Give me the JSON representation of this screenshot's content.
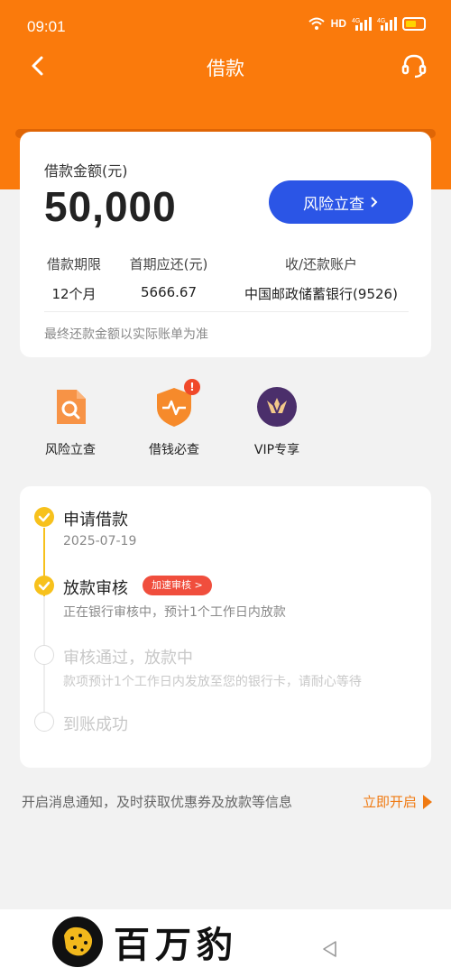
{
  "status_bar": {
    "time": "09:01",
    "hd_label": "HD",
    "signal_1": "4G",
    "signal_2": "4G"
  },
  "nav": {
    "title": "借款"
  },
  "loan": {
    "amount_label": "借款金额(元)",
    "amount": "50,000",
    "risk_button": "风险立查",
    "term_label": "借款期限",
    "term_value": "12个月",
    "first_payment_label": "首期应还(元)",
    "first_payment_value": "5666.67",
    "account_label": "收/还款账户",
    "account_value": "中国邮政储蓄银行(9526)",
    "note": "最终还款金额以实际账单为准"
  },
  "quick_links": [
    {
      "label": "风险立查",
      "icon": "document-search-icon"
    },
    {
      "label": "借钱必查",
      "icon": "shield-pulse-icon",
      "badge": "!"
    },
    {
      "label": "VIP专享",
      "icon": "vip-crown-icon"
    }
  ],
  "progress": {
    "steps": [
      {
        "title": "申请借款",
        "subtitle": "2025-07-19",
        "status": "done"
      },
      {
        "title": "放款审核",
        "subtitle": "正在银行审核中，预计1个工作日内放款",
        "status": "done",
        "tag": "加速审核 >"
      },
      {
        "title": "审核通过，放款中",
        "subtitle": "款项预计1个工作日内发放至您的银行卡，请耐心等待",
        "status": "pending"
      },
      {
        "title": "到账成功",
        "subtitle": "",
        "status": "pending"
      }
    ]
  },
  "notify": {
    "text": "开启消息通知，及时获取优惠券及放款等信息",
    "link": "立即开启"
  },
  "watermark": {
    "text": "百万豹"
  },
  "colors": {
    "brand_orange": "#fa7a0c",
    "primary_blue": "#2b55e6",
    "step_done": "#f7c11c",
    "tag_red": "#f04e3d"
  }
}
